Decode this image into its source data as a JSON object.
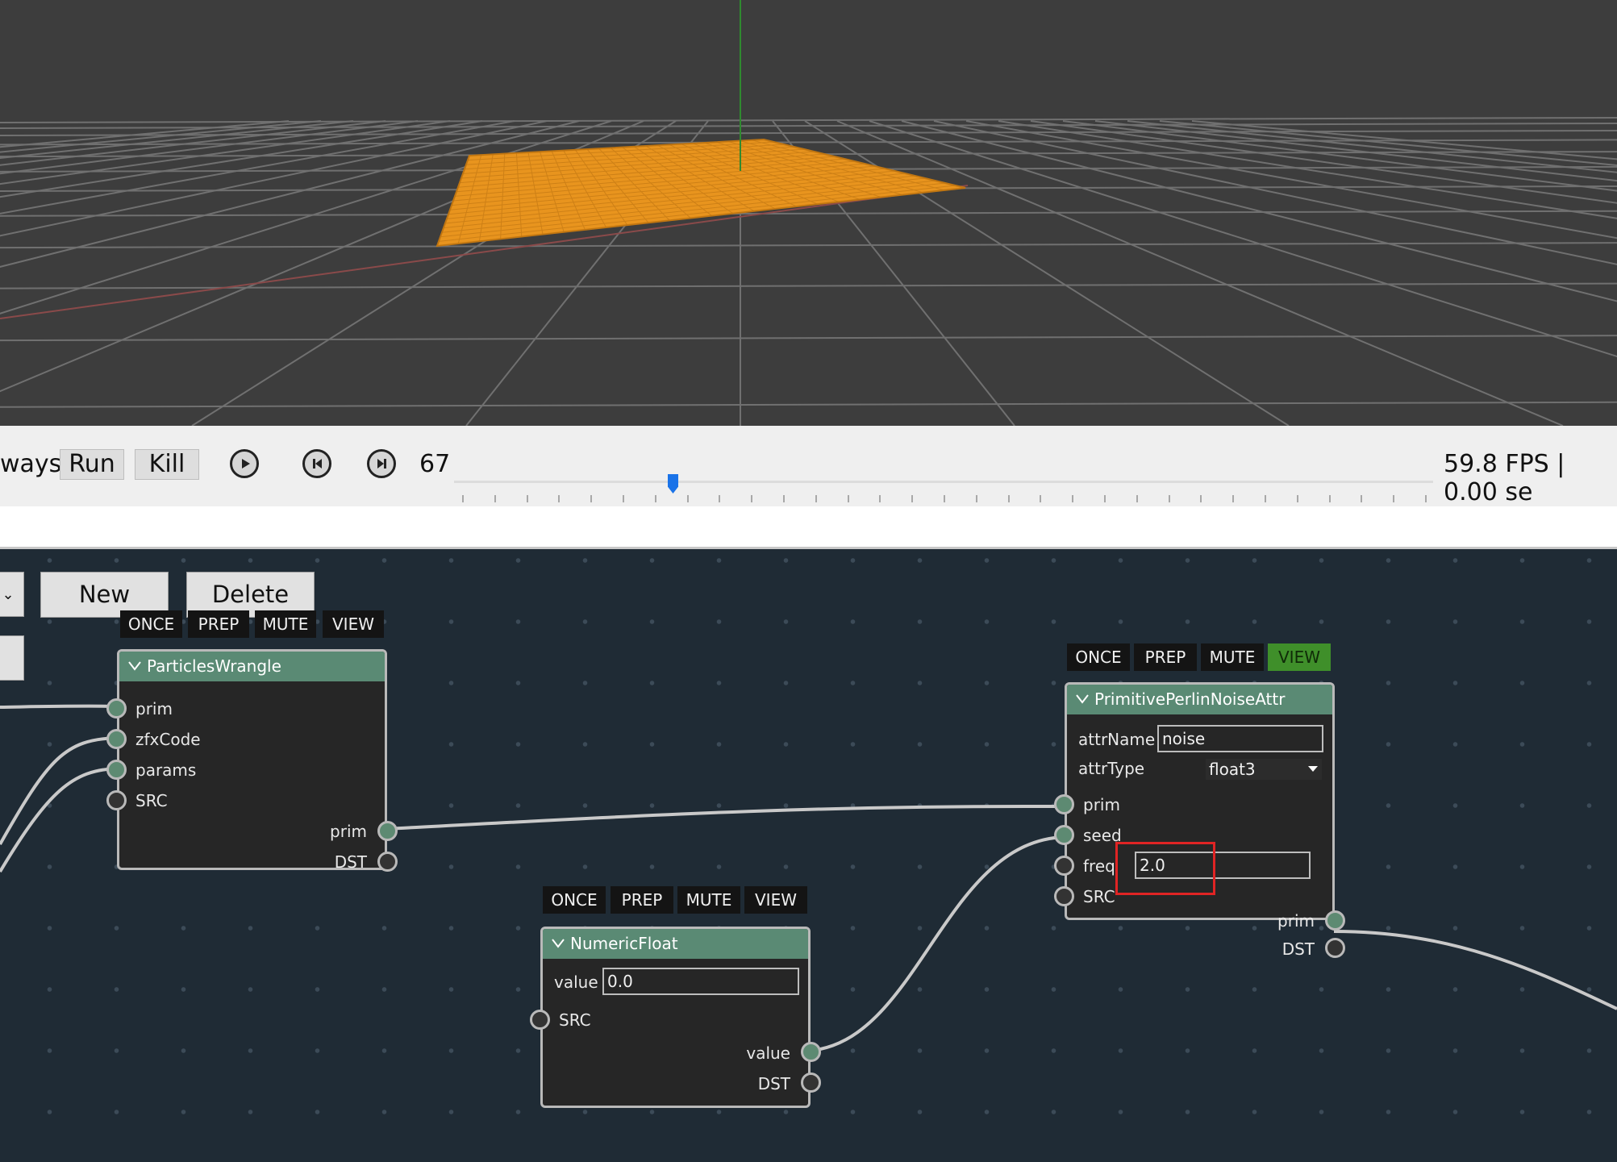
{
  "viewport": {
    "grid_color": "#7a7a7a",
    "plane_color": "#e8941e",
    "y_axis_color": "#2f8a2f",
    "x_axis_color": "#8a3a3a"
  },
  "toolbar": {
    "mode_label": "ways",
    "run_label": "Run",
    "kill_label": "Kill",
    "play_icon": "play-icon",
    "prev_icon": "step-back-icon",
    "next_icon": "step-forward-icon",
    "frame": "67",
    "slider_value": 0.223,
    "fps": "59.8 FPS | 0.00 se"
  },
  "editor": {
    "new_label": "New",
    "delete_label": "Delete",
    "nodes": [
      {
        "title": "ParticlesWrangle",
        "toggles": [
          "ONCE",
          "PREP",
          "MUTE",
          "VIEW"
        ],
        "inputs": [
          "prim",
          "zfxCode",
          "params",
          "SRC"
        ],
        "outputs": [
          "prim",
          "DST"
        ]
      },
      {
        "title": "PrimitivePerlinNoiseAttr",
        "toggles": [
          "ONCE",
          "PREP",
          "MUTE",
          "VIEW"
        ],
        "view_active": true,
        "attrName_label": "attrName",
        "attrName_value": "noise",
        "attrType_label": "attrType",
        "attrType_value": "float3",
        "inputs": [
          "prim",
          "seed",
          "freq",
          "SRC"
        ],
        "freq_value": "2.0",
        "outputs": [
          "prim",
          "DST"
        ]
      },
      {
        "title": "NumericFloat",
        "toggles": [
          "ONCE",
          "PREP",
          "MUTE",
          "VIEW"
        ],
        "value_label": "value",
        "value_value": "0.0",
        "inputs": [
          "SRC"
        ],
        "outputs": [
          "value",
          "DST"
        ]
      }
    ]
  }
}
